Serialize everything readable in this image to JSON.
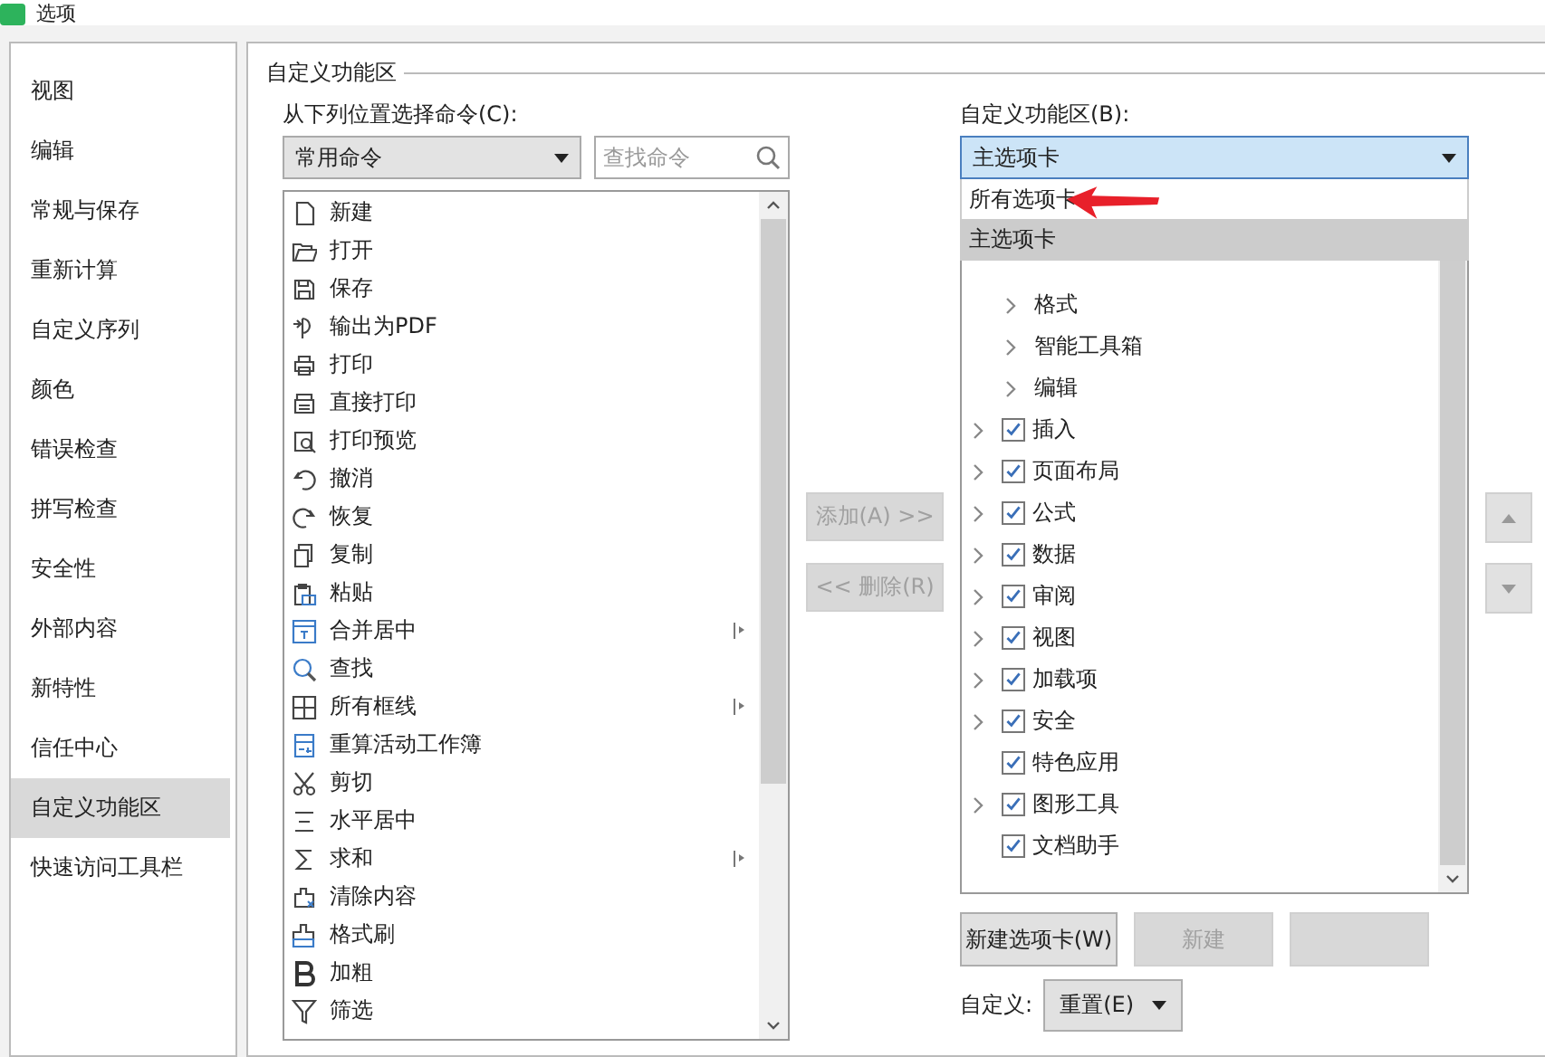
{
  "window": {
    "title": "选项"
  },
  "sidebar": {
    "items": [
      {
        "label": "视图",
        "selected": false
      },
      {
        "label": "编辑",
        "selected": false
      },
      {
        "label": "常规与保存",
        "selected": false
      },
      {
        "label": "重新计算",
        "selected": false
      },
      {
        "label": "自定义序列",
        "selected": false
      },
      {
        "label": "颜色",
        "selected": false
      },
      {
        "label": "错误检查",
        "selected": false
      },
      {
        "label": "拼写检查",
        "selected": false
      },
      {
        "label": "安全性",
        "selected": false
      },
      {
        "label": "外部内容",
        "selected": false
      },
      {
        "label": "新特性",
        "selected": false
      },
      {
        "label": "信任中心",
        "selected": false
      },
      {
        "label": "自定义功能区",
        "selected": true
      },
      {
        "label": "快速访问工具栏",
        "selected": false
      }
    ]
  },
  "section_title": "自定义功能区",
  "commands": {
    "label": "从下列位置选择命令(C):",
    "source": "常用命令",
    "search": {
      "placeholder": "查找命令"
    },
    "items": [
      {
        "label": "新建",
        "submenu": false
      },
      {
        "label": "打开",
        "submenu": false
      },
      {
        "label": "保存",
        "submenu": false
      },
      {
        "label": "输出为PDF",
        "submenu": false
      },
      {
        "label": "打印",
        "submenu": false
      },
      {
        "label": "直接打印",
        "submenu": false
      },
      {
        "label": "打印预览",
        "submenu": false
      },
      {
        "label": "撤消",
        "submenu": false
      },
      {
        "label": "恢复",
        "submenu": false
      },
      {
        "label": "复制",
        "submenu": false
      },
      {
        "label": "粘贴",
        "submenu": false
      },
      {
        "label": "合并居中",
        "submenu": true
      },
      {
        "label": "查找",
        "submenu": false
      },
      {
        "label": "所有框线",
        "submenu": true
      },
      {
        "label": "重算活动工作簿",
        "submenu": false
      },
      {
        "label": "剪切",
        "submenu": false
      },
      {
        "label": "水平居中",
        "submenu": false
      },
      {
        "label": "求和",
        "submenu": true
      },
      {
        "label": "清除内容",
        "submenu": false
      },
      {
        "label": "格式刷",
        "submenu": false
      },
      {
        "label": "加粗",
        "submenu": false
      },
      {
        "label": "筛选",
        "submenu": false
      }
    ]
  },
  "transfer_buttons": [
    {
      "label": "添加(A) >>",
      "disabled": true
    },
    {
      "label": "<< 删除(R)",
      "disabled": true
    }
  ],
  "ribbon": {
    "label": "自定义功能区(B):",
    "value": "主选项卡",
    "dropdown_options": [
      {
        "label": "所有选项卡",
        "selected": false
      },
      {
        "label": "主选项卡",
        "selected": true
      }
    ],
    "tree": [
      {
        "children": [
          {
            "label": "格式",
            "expandable": true
          },
          {
            "label": "智能工具箱",
            "expandable": true
          },
          {
            "label": "编辑",
            "expandable": true
          }
        ]
      },
      {
        "label": "插入",
        "expandable": true,
        "checked": true
      },
      {
        "label": "页面布局",
        "expandable": true,
        "checked": true
      },
      {
        "label": "公式",
        "expandable": true,
        "checked": true
      },
      {
        "label": "数据",
        "expandable": true,
        "checked": true
      },
      {
        "label": "审阅",
        "expandable": true,
        "checked": true
      },
      {
        "label": "视图",
        "expandable": true,
        "checked": true
      },
      {
        "label": "加载项",
        "expandable": true,
        "checked": true
      },
      {
        "label": "安全",
        "expandable": true,
        "checked": true
      },
      {
        "label": "特色应用",
        "expandable": false,
        "checked": true
      },
      {
        "label": "图形工具",
        "expandable": true,
        "checked": true
      },
      {
        "label": "文档助手",
        "expandable": false,
        "checked": true
      }
    ]
  },
  "bottom_buttons": [
    {
      "label": "新建选项卡(W)",
      "disabled": false
    },
    {
      "label": "新建",
      "disabled": true
    },
    {
      "disabled": true
    }
  ],
  "customize": {
    "label": "自定义:",
    "button": "重置(E)"
  }
}
